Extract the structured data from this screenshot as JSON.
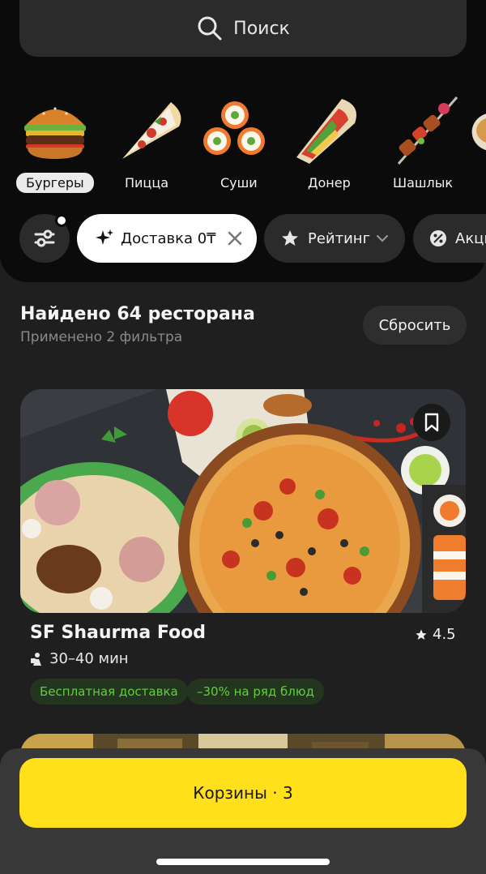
{
  "search": {
    "label": "Поиск",
    "icon": "search-icon"
  },
  "categories": [
    {
      "label": "Бургеры",
      "icon": "burger-icon",
      "active": true
    },
    {
      "label": "Пицца",
      "icon": "pizza-icon",
      "active": false
    },
    {
      "label": "Суши",
      "icon": "sushi-icon",
      "active": false
    },
    {
      "label": "Донер",
      "icon": "doner-icon",
      "active": false
    },
    {
      "label": "Шашлык",
      "icon": "shashlik-icon",
      "active": false
    }
  ],
  "filters": {
    "settings_icon": "filter-settings-icon",
    "delivery_chip": "Доставка 0₸",
    "rating_chip": "Рейтинг",
    "promo_chip": "Акции"
  },
  "results": {
    "title": "Найдено 64 ресторана",
    "subtitle": "Применено 2 фильтра",
    "reset_label": "Сбросить"
  },
  "restaurant": {
    "name": "SF Shaurma Food",
    "rating": "4.5",
    "eta": "30–40 мин",
    "badges": [
      "Бесплатная доставка",
      "–30% на ряд блюд"
    ]
  },
  "cart": {
    "label": "Корзины · 3"
  },
  "colors": {
    "accent_yellow": "#ffe01a",
    "badge_green": "#5fcf3d",
    "panel_dark": "#0b0b0b",
    "page_bg": "#1f1f1f"
  }
}
